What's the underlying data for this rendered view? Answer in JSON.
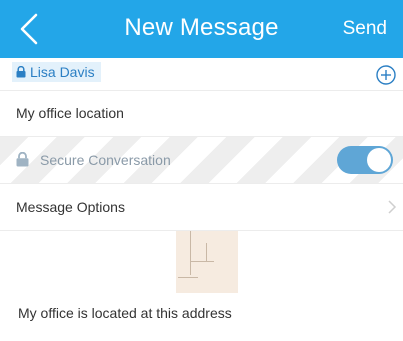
{
  "header": {
    "title": "New Message",
    "send_label": "Send",
    "back_icon": "chevron-left-icon",
    "color": "#23a6e8"
  },
  "recipient": {
    "name": "Lisa Davis",
    "icon": "lock-icon",
    "add_icon": "plus-circle-icon"
  },
  "subject": {
    "value": "My office location"
  },
  "secure": {
    "label": "Secure Conversation",
    "icon": "lock-icon",
    "enabled": true,
    "toggle_color": "#5fa6d6"
  },
  "options": {
    "label": "Message Options",
    "icon": "chevron-right-icon"
  },
  "attachment": {
    "icon": "map-thumbnail"
  },
  "message": {
    "text": "My office is located at this address"
  }
}
